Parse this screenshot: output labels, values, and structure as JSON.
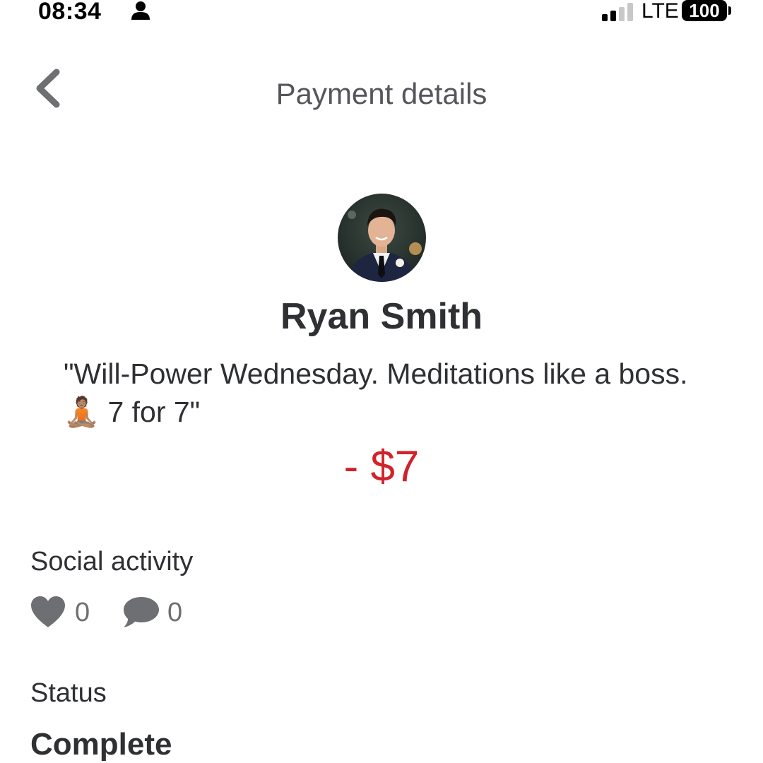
{
  "status_bar": {
    "time": "08:34",
    "network": "LTE",
    "battery": "100"
  },
  "header": {
    "title": "Payment details",
    "back_icon": "chevron-left-icon"
  },
  "payment": {
    "user_name": "Ryan Smith",
    "note": "\"Will-Power Wednesday. Meditations like a boss. 🧘🏽 7 for 7\"",
    "amount": "- $7",
    "amount_color": "#d1232a"
  },
  "social": {
    "label": "Social activity",
    "likes": "0",
    "comments": "0",
    "like_icon": "heart-icon",
    "comment_icon": "comment-bubble-icon"
  },
  "status": {
    "label": "Status",
    "value": "Complete"
  },
  "colors": {
    "text_primary": "#2f3033",
    "text_secondary": "#6e6f73",
    "icon_gray": "#6e6f73"
  }
}
